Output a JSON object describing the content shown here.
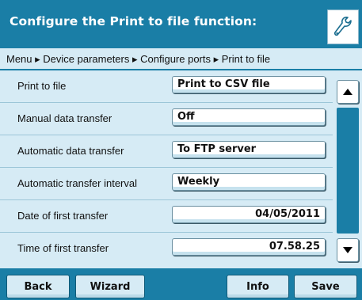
{
  "header": {
    "title": "Configure the Print to file function:",
    "icon": "wrench-icon"
  },
  "breadcrumb": {
    "text": "Menu ▸ Device parameters ▸ Configure ports ▸ Print to file"
  },
  "settings": [
    {
      "label": "Print to file",
      "value": "Print to CSV file"
    },
    {
      "label": "Manual data transfer",
      "value": "Off"
    },
    {
      "label": "Automatic data transfer",
      "value": "To FTP server"
    },
    {
      "label": "Automatic transfer interval",
      "value": "Weekly"
    },
    {
      "label": "Date of first transfer",
      "value": "04/05/2011"
    },
    {
      "label": "Time of first transfer",
      "value": "07.58.25"
    }
  ],
  "scroll": {
    "up_icon": "triangle-up-icon",
    "down_icon": "triangle-down-icon"
  },
  "toolbar": {
    "back_label": "Back",
    "wizard_label": "Wizard",
    "info_label": "Info",
    "save_label": "Save"
  },
  "colors": {
    "accent": "#1a7ea6",
    "panel": "#d6ebf5"
  }
}
